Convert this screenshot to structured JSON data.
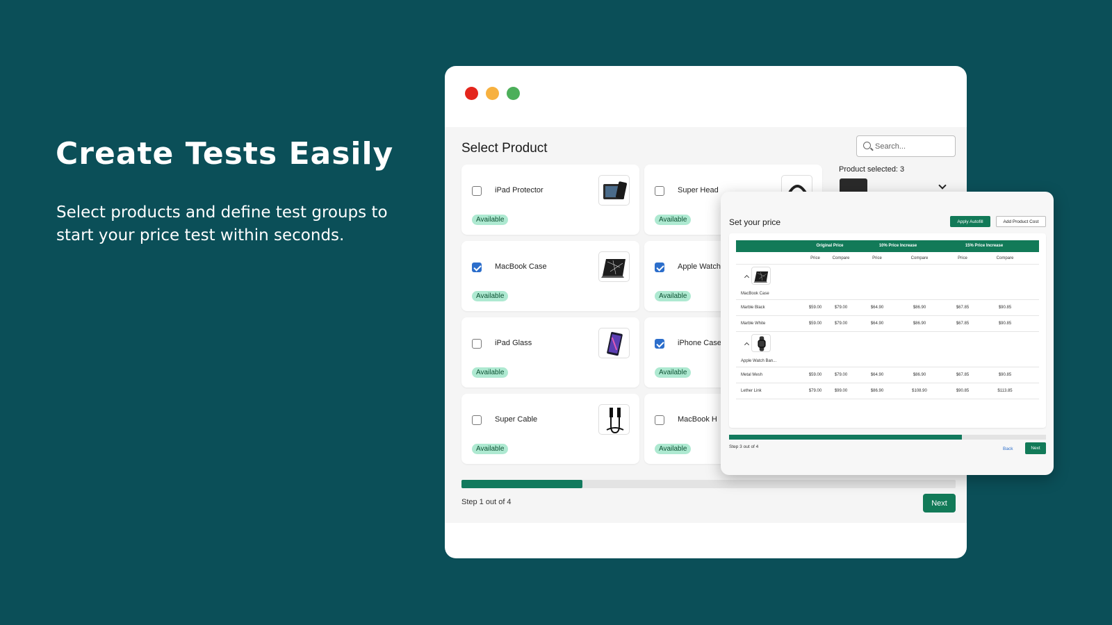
{
  "hero": {
    "title": "Create Tests Easily",
    "subtitle": "Select products and define test groups to start your price test within seconds."
  },
  "select_panel": {
    "title": "Select Product",
    "search_placeholder": "Search...",
    "product_selected": "Product selected: 3",
    "step": "Step 1 out of 4",
    "progress": 0.245,
    "next": "Next",
    "cards": [
      {
        "name": "iPad Protector",
        "status": "Available",
        "checked": false,
        "thumb": "ipad-icon"
      },
      {
        "name": "Super Head",
        "status": "Available",
        "checked": false,
        "thumb": "headphones-icon"
      },
      {
        "name": "MacBook Case",
        "status": "Available",
        "checked": true,
        "thumb": "laptop-icon"
      },
      {
        "name": "Apple Watch",
        "status": "Available",
        "checked": true,
        "thumb": "watch-icon"
      },
      {
        "name": "iPad Glass",
        "status": "Available",
        "checked": false,
        "thumb": "tablet-icon"
      },
      {
        "name": "iPhone Case",
        "status": "Available",
        "checked": true,
        "thumb": "phone-icon"
      },
      {
        "name": "Super Cable",
        "status": "Available",
        "checked": false,
        "thumb": "cable-icon"
      },
      {
        "name": "MacBook H",
        "status": "Available",
        "checked": false,
        "thumb": "laptop-icon"
      }
    ]
  },
  "price_panel": {
    "title": "Set your price",
    "apply_autofill": "Apply Autofill",
    "add_product_cost": "Add Product Cost",
    "groups": [
      "Original Price",
      "10% Price Increase",
      "15% Price Increase"
    ],
    "subheads": [
      "Price",
      "Compare",
      "Price",
      "Compare",
      "Price",
      "Compare"
    ],
    "products": [
      {
        "name": "MacBook Case",
        "thumb": "laptop-icon",
        "variants": [
          {
            "name": "Marble Black",
            "values": [
              "$59.00",
              "$79.00",
              "$64.90",
              "$86.90",
              "$67.85",
              "$90.85"
            ]
          },
          {
            "name": "Marble White",
            "values": [
              "$59.00",
              "$79.00",
              "$64.90",
              "$86.90",
              "$67.85",
              "$90.85"
            ]
          }
        ]
      },
      {
        "name": "Apple Watch Ban...",
        "thumb": "watch-icon",
        "variants": [
          {
            "name": "Metal Mesh",
            "values": [
              "$59.00",
              "$79.00",
              "$64.90",
              "$86.90",
              "$67.85",
              "$90.85"
            ]
          },
          {
            "name": "Lether Link",
            "values": [
              "$79.00",
              "$99.00",
              "$86.90",
              "$108.90",
              "$90.85",
              "$113.85"
            ]
          }
        ]
      }
    ],
    "step": "Step 3 out of 4",
    "progress": 0.735,
    "back": "Back",
    "next": "Next"
  },
  "colors": {
    "background": "#0b4f58",
    "accent": "#127a58",
    "checkbox": "#2c6ecb",
    "badge_bg": "#aee9d1",
    "dot_red": "#e4251c",
    "dot_yellow": "#f7b13f",
    "dot_green": "#4caf5a"
  }
}
